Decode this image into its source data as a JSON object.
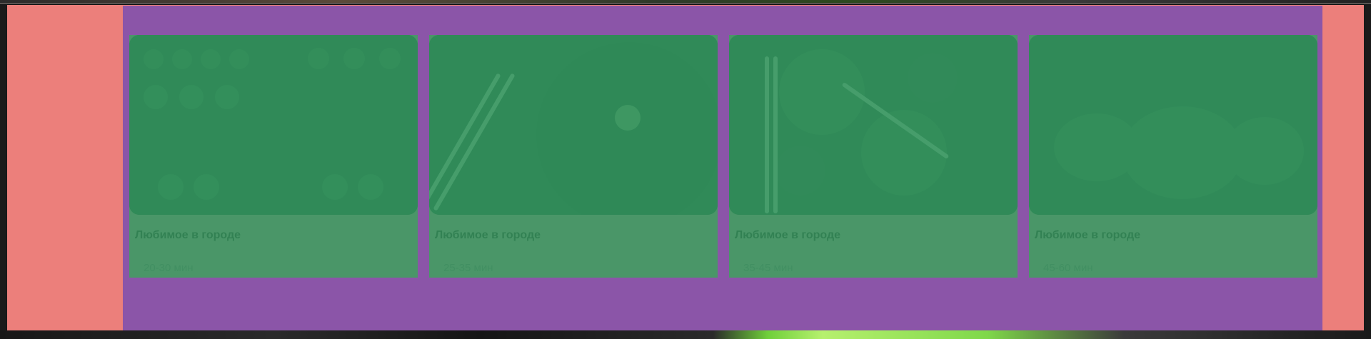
{
  "cards": [
    {
      "title": "Любимое в городе",
      "time": "20-30 мин",
      "image": "sushi-platter"
    },
    {
      "title": "Любимое в городе",
      "time": "25-35 мин",
      "image": "noodle-bowl"
    },
    {
      "title": "Любимое в городе",
      "time": "35-45 мин",
      "image": "noodle-bowls-set"
    },
    {
      "title": "Любимое в городе",
      "time": "45-60 мин",
      "image": "burgers"
    }
  ],
  "colors": {
    "outer_band": "#ec7f7b",
    "panel": "#8b55a8",
    "card_bg": "#4a9668",
    "photo_overlay": "rgba(47,145,91,0.65)"
  }
}
